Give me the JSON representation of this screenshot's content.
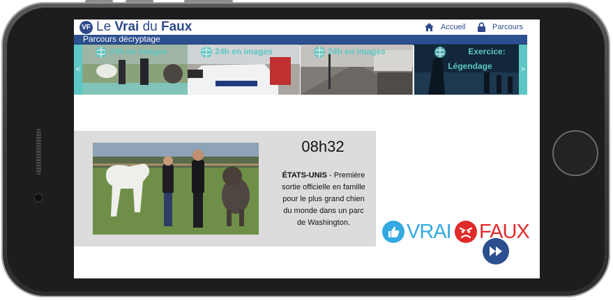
{
  "app": {
    "logo_badge": "VF",
    "logo_light_1": "Le ",
    "logo_bold_1": "Vrai",
    "logo_light_2": " du ",
    "logo_bold_2": "Faux"
  },
  "nav": {
    "home_label": "Accueil",
    "home_icon": "home-icon",
    "parcours_label": "Parcours",
    "parcours_icon": "lock-icon"
  },
  "subheader": {
    "title": "Parcours décryptage"
  },
  "carousel": {
    "prev_label": "<",
    "next_label": ">",
    "tiles": [
      {
        "title": "24h en images",
        "subtitle": ""
      },
      {
        "title": "24h en images",
        "subtitle": ""
      },
      {
        "title": "24h en images",
        "subtitle": ""
      },
      {
        "title": "Exercice:",
        "subtitle": "Légendage"
      }
    ]
  },
  "card": {
    "time": "08h32",
    "location": "ÉTATS-UNIS",
    "text": " - Première sortie officielle en famille pour le plus grand chien du monde dans un parc de Washington."
  },
  "answers": {
    "vrai_label": "VRAI",
    "faux_label": "FAUX",
    "vrai_icon": "thumbs-up-icon",
    "faux_icon": "angry-face-icon",
    "next_icon": "fast-forward-icon"
  },
  "colors": {
    "brand_blue": "#2c4f8f",
    "accent_teal": "#5cc7c4",
    "vrai_blue": "#34a9e1",
    "faux_red": "#e02b2b"
  }
}
